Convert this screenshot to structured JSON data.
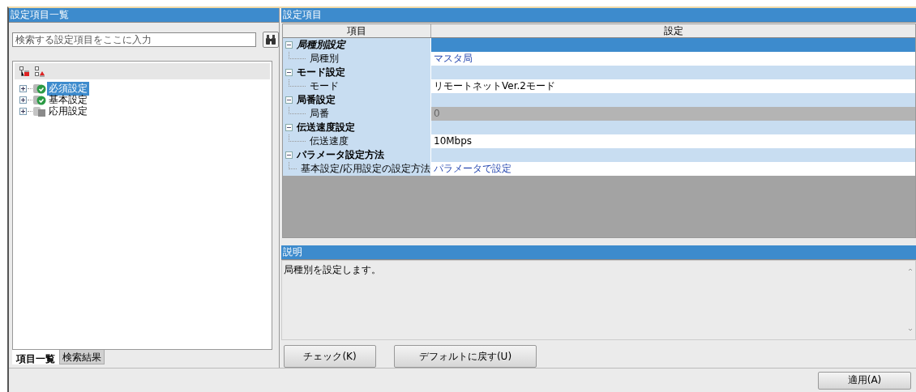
{
  "left_panel": {
    "title": "設定項目一覧",
    "search": {
      "placeholder": "検索する設定項目をここに入力"
    },
    "tree": [
      {
        "label": "必須設定",
        "kind": "done",
        "expanded": false,
        "selected": true
      },
      {
        "label": "基本設定",
        "kind": "done",
        "expanded": false,
        "selected": false
      },
      {
        "label": "応用設定",
        "kind": "pending",
        "expanded": false,
        "selected": false
      }
    ],
    "tabs": [
      {
        "label": "項目一覧",
        "selected": true
      },
      {
        "label": "検索結果",
        "selected": false
      }
    ]
  },
  "right_panel": {
    "title": "設定項目",
    "table": {
      "columns": [
        "項目",
        "設定"
      ],
      "groups": [
        {
          "label": "局種別設定",
          "expanded": true,
          "selected": true,
          "items": [
            {
              "label": "局種別",
              "value": "マスタ局",
              "kind": "choice"
            }
          ]
        },
        {
          "label": "モード設定",
          "expanded": true,
          "selected": false,
          "items": [
            {
              "label": "モード",
              "value": "リモートネットVer.2モード",
              "kind": "text"
            }
          ]
        },
        {
          "label": "局番設定",
          "expanded": true,
          "selected": false,
          "items": [
            {
              "label": "局番",
              "value": "0",
              "kind": "disabled"
            }
          ]
        },
        {
          "label": "伝送速度設定",
          "expanded": true,
          "selected": false,
          "items": [
            {
              "label": "伝送速度",
              "value": "10Mbps",
              "kind": "text"
            }
          ]
        },
        {
          "label": "パラメータ設定方法",
          "expanded": true,
          "selected": false,
          "items": [
            {
              "label": "基本設定/応用設定の設定方法",
              "value": "パラメータで設定",
              "kind": "choice"
            }
          ]
        }
      ]
    },
    "description": {
      "title": "説明",
      "text": "局種別を設定します。"
    },
    "buttons": [
      "チェック(K)",
      "デフォルトに戻す(U)"
    ]
  },
  "apply_button": "適用(A)"
}
